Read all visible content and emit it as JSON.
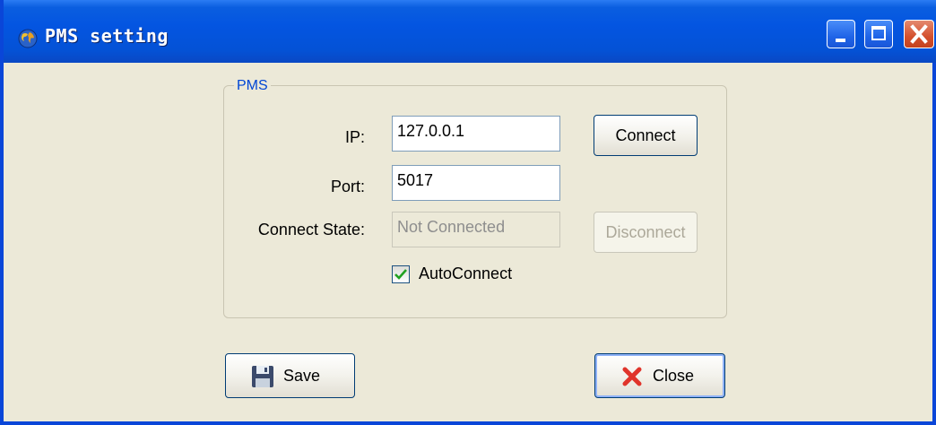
{
  "window": {
    "title": "PMS setting"
  },
  "group": {
    "title": "PMS"
  },
  "form": {
    "ip_label": "IP:",
    "ip_value": "127.0.0.1",
    "port_label": "Port:",
    "port_value": "5017",
    "state_label": "Connect State:",
    "state_value": "Not Connected",
    "autoconnect_label": "AutoConnect",
    "autoconnect_checked": true
  },
  "buttons": {
    "connect": "Connect",
    "disconnect": "Disconnect",
    "save": "Save",
    "close": "Close"
  },
  "colors": {
    "titlebar": "#0455e1",
    "face": "#ece9d8",
    "group_title": "#0046d5",
    "close_icon": "#e0342b"
  }
}
